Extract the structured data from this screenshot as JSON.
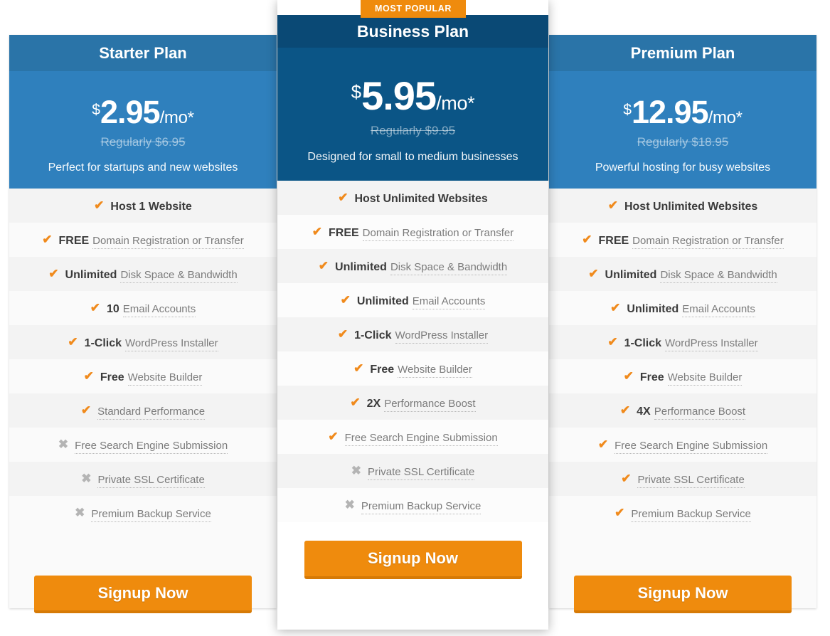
{
  "plans": [
    {
      "id": "starter",
      "name": "Starter Plan",
      "currency": "$",
      "amount": "2.95",
      "per": "/mo*",
      "regular": "Regularly $6.95",
      "tagline": "Perfect for startups and new websites",
      "cta": "Signup Now",
      "features": [
        {
          "mark": "check",
          "strong": "Host 1 Website",
          "rest": ""
        },
        {
          "mark": "check",
          "strong": "FREE",
          "rest": "Domain Registration or Transfer"
        },
        {
          "mark": "check",
          "strong": "Unlimited",
          "rest": "Disk Space & Bandwidth"
        },
        {
          "mark": "check",
          "strong": "10",
          "rest": "Email Accounts"
        },
        {
          "mark": "check",
          "strong": "1-Click",
          "rest": "WordPress Installer"
        },
        {
          "mark": "check",
          "strong": "Free",
          "rest": "Website Builder"
        },
        {
          "mark": "check",
          "strong": "",
          "rest": "Standard Performance"
        },
        {
          "mark": "cross",
          "strong": "",
          "rest": "Free Search Engine Submission"
        },
        {
          "mark": "cross",
          "strong": "",
          "rest": "Private SSL Certificate"
        },
        {
          "mark": "cross",
          "strong": "",
          "rest": "Premium Backup Service"
        }
      ]
    },
    {
      "id": "business",
      "name": "Business Plan",
      "badge": "MOST POPULAR",
      "currency": "$",
      "amount": "5.95",
      "per": "/mo*",
      "regular": "Regularly $9.95",
      "tagline": "Designed for small to medium businesses",
      "cta": "Signup Now",
      "features": [
        {
          "mark": "check",
          "strong": "Host Unlimited Websites",
          "rest": ""
        },
        {
          "mark": "check",
          "strong": "FREE",
          "rest": "Domain Registration or Transfer"
        },
        {
          "mark": "check",
          "strong": "Unlimited",
          "rest": "Disk Space & Bandwidth"
        },
        {
          "mark": "check",
          "strong": "Unlimited",
          "rest": "Email Accounts"
        },
        {
          "mark": "check",
          "strong": "1-Click",
          "rest": "WordPress Installer"
        },
        {
          "mark": "check",
          "strong": "Free",
          "rest": "Website Builder"
        },
        {
          "mark": "check",
          "strong": "2X",
          "rest": "Performance Boost"
        },
        {
          "mark": "check",
          "strong": "",
          "rest": "Free Search Engine Submission"
        },
        {
          "mark": "cross",
          "strong": "",
          "rest": "Private SSL Certificate"
        },
        {
          "mark": "cross",
          "strong": "",
          "rest": "Premium Backup Service"
        }
      ]
    },
    {
      "id": "premium",
      "name": "Premium Plan",
      "currency": "$",
      "amount": "12.95",
      "per": "/mo*",
      "regular": "Regularly $18.95",
      "tagline": "Powerful hosting for busy websites",
      "cta": "Signup Now",
      "features": [
        {
          "mark": "check",
          "strong": "Host Unlimited Websites",
          "rest": ""
        },
        {
          "mark": "check",
          "strong": "FREE",
          "rest": "Domain Registration or Transfer"
        },
        {
          "mark": "check",
          "strong": "Unlimited",
          "rest": "Disk Space & Bandwidth"
        },
        {
          "mark": "check",
          "strong": "Unlimited",
          "rest": "Email Accounts"
        },
        {
          "mark": "check",
          "strong": "1-Click",
          "rest": "WordPress Installer"
        },
        {
          "mark": "check",
          "strong": "Free",
          "rest": "Website Builder"
        },
        {
          "mark": "check",
          "strong": "4X",
          "rest": "Performance Boost"
        },
        {
          "mark": "check",
          "strong": "",
          "rest": "Free Search Engine Submission"
        },
        {
          "mark": "check",
          "strong": "",
          "rest": "Private SSL Certificate"
        },
        {
          "mark": "check",
          "strong": "",
          "rest": "Premium Backup Service"
        }
      ]
    }
  ],
  "icons": {
    "check": "✔",
    "cross": "✖"
  },
  "colors": {
    "accent_orange": "#ef8b0d",
    "header_blue": "#2a74a8",
    "price_blue": "#2f80bd",
    "featured_header": "#0a4975",
    "featured_price": "#0b5586",
    "check_orange": "#f08a1c",
    "cross_gray": "#b4b4b4"
  }
}
